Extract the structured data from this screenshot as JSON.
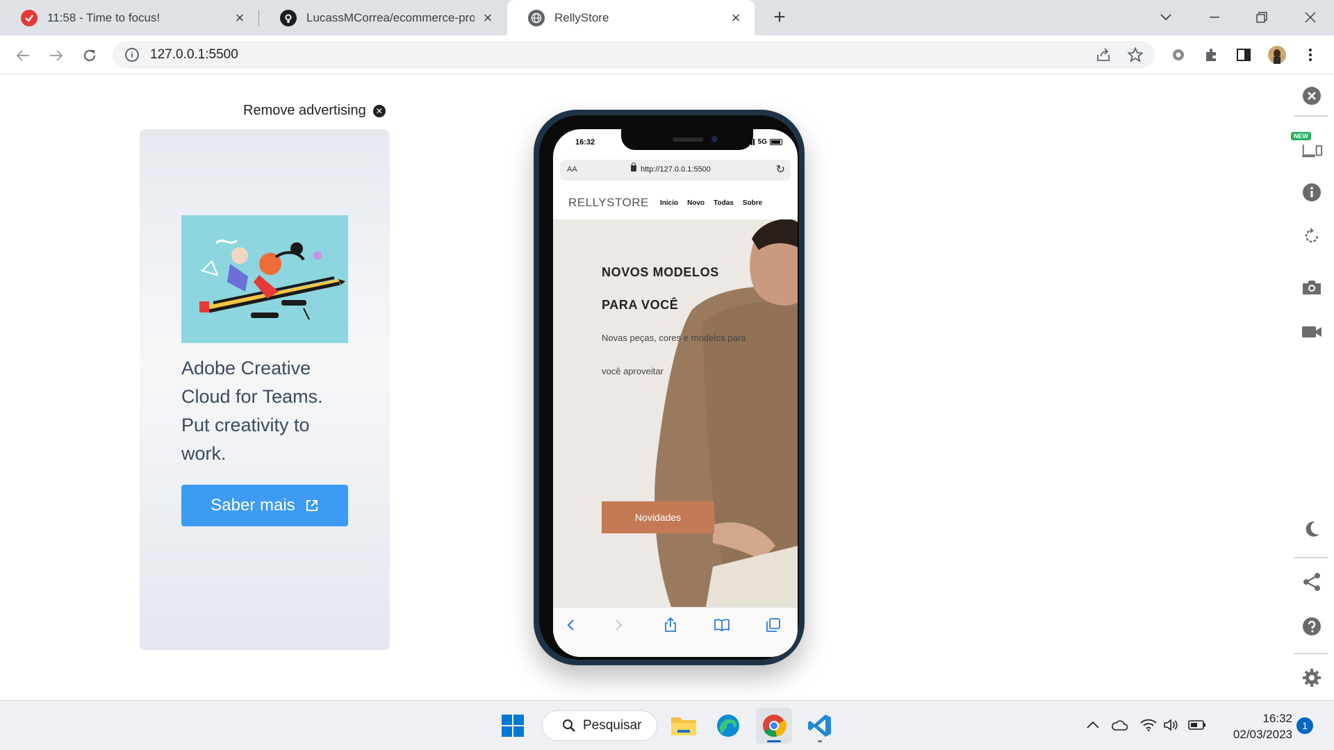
{
  "browser": {
    "tabs": [
      {
        "title": "11:58 - Time to focus!",
        "icon": "check-circle-icon",
        "active": false
      },
      {
        "title": "LucassMCorrea/ecommerce-proj",
        "icon": "github-icon",
        "active": false
      },
      {
        "title": "RellyStore",
        "icon": "globe-icon",
        "active": true
      }
    ],
    "new_tab": "+",
    "address": "127.0.0.1:5500"
  },
  "ad": {
    "remove_label": "Remove advertising",
    "text": "Adobe Creative Cloud for Teams. Put creativity to work.",
    "button_label": "Saber mais",
    "image_icon": "illustration-pencil-rider"
  },
  "phone": {
    "status_time": "16:32",
    "network": "5G",
    "safari": {
      "aa": "AA",
      "url": "http://127.0.0.1:5500"
    },
    "site": {
      "logo": "RELLYSTORE",
      "nav": [
        "Inicio",
        "Novo",
        "Todas",
        "Sobre"
      ],
      "hero_title_1": "NOVOS MODELOS",
      "hero_title_2": "PARA VOCÊ",
      "hero_sub_1": "Novas peças, cores e modelos para",
      "hero_sub_2": "você aproveitar",
      "hero_button": "Novidades"
    }
  },
  "sidebar": {
    "new_badge": "NEW",
    "icons": [
      "close-icon",
      "responsive-devices-icon",
      "info-icon",
      "rotate-icon",
      "camera-icon",
      "video-icon",
      "moon-icon",
      "share-icon",
      "help-icon",
      "settings-icon"
    ]
  },
  "taskbar": {
    "search_label": "Pesquisar",
    "time": "16:32",
    "date": "02/03/2023",
    "notifications": "1"
  },
  "colors": {
    "ad_button": "#3d9bf4",
    "hero_button": "#c47a57",
    "phone_frame": "#1f3348",
    "taskbar_accent": "#0067c0"
  }
}
